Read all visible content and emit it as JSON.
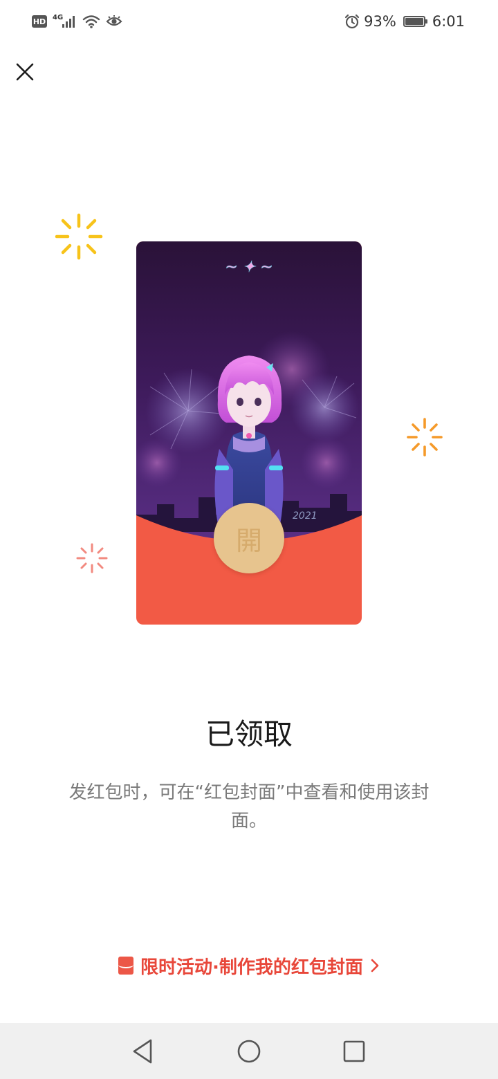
{
  "status_bar": {
    "hd_label": "HD",
    "network_type": "4G",
    "battery_percent": "93%",
    "battery_level": 0.93,
    "time": "6:01"
  },
  "icons": {
    "close": "close-icon",
    "signal": "signal-icon",
    "wifi": "wifi-icon",
    "eye": "eye-comfort-icon",
    "alarm": "alarm-icon",
    "battery": "battery-icon",
    "promo": "red-packet-icon",
    "chevron": "chevron-right-icon"
  },
  "envelope": {
    "year_text": "2021",
    "open_label": "開"
  },
  "status_title": "已领取",
  "description": "发红包时，可在“红包封面”中查看和使用该封面。",
  "promo": {
    "label": "限时活动·制作我的红包封面"
  },
  "colors": {
    "accent": "#e8473a",
    "envelope_red": "#f25a45",
    "open_button": "#e7c48e",
    "sparkle_yellow": "#f7c31a",
    "sparkle_orange": "#f59a2a",
    "sparkle_pink": "#f28a80"
  }
}
